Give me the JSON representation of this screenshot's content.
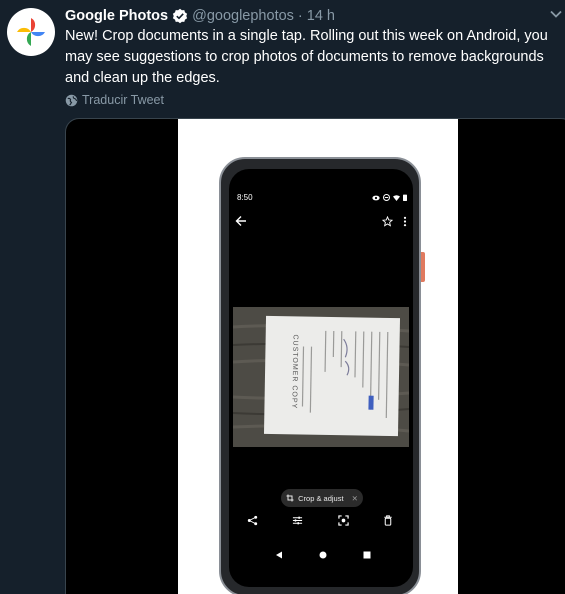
{
  "tweet": {
    "author_name": "Google Photos",
    "handle": "@googlephotos",
    "separator": "·",
    "time": "14 h",
    "text": "New! Crop documents in a single tap. Rolling out this week on Android, you may see suggestions to crop photos of documents to remove backgrounds and clean up the edges.",
    "translate_label": "Traducir Tweet"
  },
  "media": {
    "phone_time": "8:50",
    "suggestion_chip": "Crop & adjust",
    "receipt_text": "CUSTOMER COPY",
    "icons": {
      "back": "arrow-left-icon",
      "favorite": "star-icon",
      "menu": "more-vert-icon",
      "chip": "crop-icon",
      "dismiss": "close-icon",
      "share": "share-icon",
      "edit": "tune-icon",
      "lens": "lens-icon",
      "delete": "trash-icon"
    }
  },
  "colors": {
    "background": "#15202b",
    "text_primary": "#ffffff",
    "text_secondary": "#8899a6",
    "verified": "#ffffff"
  }
}
